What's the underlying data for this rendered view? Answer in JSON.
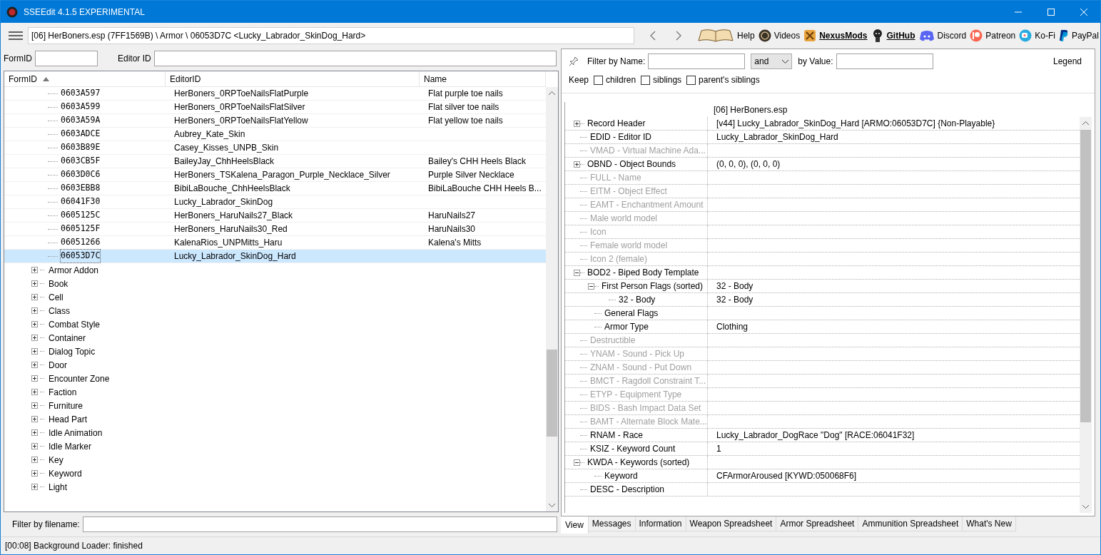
{
  "window": {
    "title": "SSEEdit 4.1.5 EXPERIMENTAL"
  },
  "toolbar": {
    "path": "[06] HerBoners.esp (7FF1569B) \\ Armor \\ 06053D7C <Lucky_Labrador_SkinDog_Hard>",
    "links": [
      {
        "kind": "book",
        "label": "Help",
        "emphasized": false
      },
      {
        "kind": "gp",
        "label": "Videos",
        "emphasized": false
      },
      {
        "kind": "nexus",
        "label": "NexusMods",
        "emphasized": true
      },
      {
        "kind": "github",
        "label": "GitHub",
        "emphasized": true
      },
      {
        "kind": "discord",
        "label": "Discord",
        "emphasized": false
      },
      {
        "kind": "patreon",
        "label": "Patreon",
        "emphasized": false
      },
      {
        "kind": "kofi",
        "label": "Ko-Fi",
        "emphasized": false
      },
      {
        "kind": "paypal",
        "label": "PayPal",
        "emphasized": false
      }
    ]
  },
  "left": {
    "formid_label": "FormID",
    "editorid_label": "Editor ID",
    "columns": [
      "FormID",
      "EditorID",
      "Name"
    ],
    "records": [
      {
        "formid": "0603A597",
        "editorid": "HerBoners_0RPToeNailsFlatPurple",
        "name": "Flat purple toe nails",
        "selected": false
      },
      {
        "formid": "0603A599",
        "editorid": "HerBoners_0RPToeNailsFlatSilver",
        "name": "Flat silver toe nails",
        "selected": false
      },
      {
        "formid": "0603A59A",
        "editorid": "HerBoners_0RPToeNailsFlatYellow",
        "name": "Flat yellow toe nails",
        "selected": false
      },
      {
        "formid": "0603ADCE",
        "editorid": "Aubrey_Kate_Skin",
        "selected": false
      },
      {
        "formid": "0603B89E",
        "editorid": "Casey_Kisses_UNPB_Skin",
        "selected": false
      },
      {
        "formid": "0603CB5F",
        "editorid": "BaileyJay_ChhHeelsBlack",
        "name": "Bailey's CHH Heels Black",
        "selected": false
      },
      {
        "formid": "0603D0C6",
        "editorid": "HerBoners_TSKalena_Paragon_Purple_Necklace_Silver",
        "name": "Purple Silver Necklace",
        "selected": false
      },
      {
        "formid": "0603EBB8",
        "editorid": "BibiLaBouche_ChhHeelsBlack",
        "name": "BibiLaBouche CHH Heels B...",
        "selected": false
      },
      {
        "formid": "06041F30",
        "editorid": "Lucky_Labrador_SkinDog",
        "selected": false
      },
      {
        "formid": "0605125C",
        "editorid": "HerBoners_HaruNails27_Black",
        "name": "HaruNails27",
        "selected": false
      },
      {
        "formid": "0605125F",
        "editorid": "HerBoners_HaruNails30_Red",
        "name": "HaruNails30",
        "selected": false
      },
      {
        "formid": "06051266",
        "editorid": "KalenaRios_UNPMitts_Haru",
        "name": "Kalena's Mitts",
        "selected": false
      },
      {
        "formid": "06053D7C",
        "editorid": "Lucky_Labrador_SkinDog_Hard",
        "selected": true
      }
    ],
    "groups": [
      {
        "label": "Armor Addon",
        "expanded": false
      },
      {
        "label": "Book",
        "expanded": false
      },
      {
        "label": "Cell",
        "expanded": false
      },
      {
        "label": "Class",
        "expanded": false
      },
      {
        "label": "Combat Style",
        "expanded": false
      },
      {
        "label": "Container",
        "expanded": false
      },
      {
        "label": "Dialog Topic",
        "expanded": false
      },
      {
        "label": "Door",
        "expanded": false
      },
      {
        "label": "Encounter Zone",
        "expanded": false
      },
      {
        "label": "Faction",
        "expanded": false
      },
      {
        "label": "Furniture",
        "expanded": false
      },
      {
        "label": "Head Part",
        "expanded": false
      },
      {
        "label": "Idle Animation",
        "expanded": false
      },
      {
        "label": "Idle Marker",
        "expanded": false
      },
      {
        "label": "Key",
        "expanded": false
      },
      {
        "label": "Keyword",
        "expanded": false
      },
      {
        "label": "Light",
        "expanded": false
      }
    ],
    "filter_label": "Filter by filename:"
  },
  "right": {
    "filter": {
      "name_label": "Filter by Name:",
      "operator": "and",
      "value_label": "by Value:",
      "legend": "Legend",
      "keep_label": "Keep",
      "options": [
        {
          "label": "children",
          "checked": false
        },
        {
          "label": "siblings",
          "checked": false
        },
        {
          "label": "parent's siblings",
          "checked": false
        }
      ]
    },
    "record": {
      "file": "[06] HerBoners.esp",
      "rows": [
        {
          "label": "Record Header",
          "value": "[v44] Lucky_Labrador_SkinDog_Hard [ARMO:06053D7C] {Non-Playable}",
          "disabled": false,
          "expanded": false
        },
        {
          "label": "EDID - Editor ID",
          "value": "Lucky_Labrador_SkinDog_Hard",
          "disabled": false
        },
        {
          "label": "VMAD - Virtual Machine Ada...",
          "disabled": true
        },
        {
          "label": "OBND - Object Bounds",
          "value": "(0, 0, 0), (0, 0, 0)",
          "disabled": false,
          "expanded": false
        },
        {
          "label": "FULL - Name",
          "disabled": true
        },
        {
          "label": "EITM - Object Effect",
          "disabled": true
        },
        {
          "label": "EAMT - Enchantment Amount",
          "disabled": true
        },
        {
          "label": "Male world model",
          "disabled": true
        },
        {
          "label": "Icon",
          "disabled": true
        },
        {
          "label": "Female world model",
          "disabled": true
        },
        {
          "label": "Icon 2 (female)",
          "disabled": true
        },
        {
          "label": "BOD2 - Biped Body Template",
          "disabled": false,
          "expanded": true,
          "children": [
            {
              "label": "First Person Flags (sorted)",
              "value": "32 - Body",
              "disabled": false,
              "expanded": true,
              "children": [
                {
                  "label": "32 - Body",
                  "value": "32 - Body",
                  "disabled": false
                }
              ]
            },
            {
              "label": "General Flags",
              "disabled": false
            },
            {
              "label": "Armor Type",
              "value": "Clothing",
              "disabled": false
            }
          ]
        },
        {
          "label": "Destructible",
          "disabled": true
        },
        {
          "label": "YNAM - Sound - Pick Up",
          "disabled": true
        },
        {
          "label": "ZNAM - Sound - Put Down",
          "disabled": true
        },
        {
          "label": "BMCT - Ragdoll Constraint T...",
          "disabled": true
        },
        {
          "label": "ETYP - Equipment Type",
          "disabled": true
        },
        {
          "label": "BIDS - Bash Impact Data Set",
          "disabled": true
        },
        {
          "label": "BAMT - Alternate Block Mate...",
          "disabled": true
        },
        {
          "label": "RNAM - Race",
          "value": "Lucky_Labrador_DogRace \"Dog\" [RACE:06041F32]",
          "disabled": false
        },
        {
          "label": "KSIZ - Keyword Count",
          "value": "1",
          "disabled": false
        },
        {
          "label": "KWDA - Keywords (sorted)",
          "disabled": false,
          "expanded": true,
          "children": [
            {
              "label": "Keyword",
              "value": "CFArmorAroused [KYWD:050068F6]",
              "disabled": false
            }
          ]
        },
        {
          "label": "DESC - Description",
          "disabled": false
        }
      ]
    },
    "tabs": [
      {
        "label": "View",
        "selected": true
      },
      {
        "label": "Messages",
        "selected": false
      },
      {
        "label": "Information",
        "selected": false
      },
      {
        "label": "Weapon Spreadsheet",
        "selected": false
      },
      {
        "label": "Armor Spreadsheet",
        "selected": false
      },
      {
        "label": "Ammunition Spreadsheet",
        "selected": false
      },
      {
        "label": "What's New",
        "selected": false
      }
    ]
  },
  "status_bar": "[00:08] Background Loader: finished"
}
